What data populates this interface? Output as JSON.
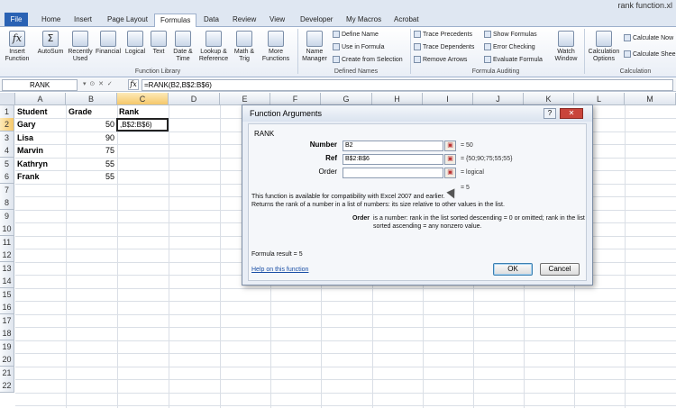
{
  "window": {
    "title": "rank function.xl"
  },
  "ribbon_tabs": [
    {
      "label": "File"
    },
    {
      "label": "Home"
    },
    {
      "label": "Insert"
    },
    {
      "label": "Page Layout"
    },
    {
      "label": "Formulas"
    },
    {
      "label": "Data"
    },
    {
      "label": "Review"
    },
    {
      "label": "View"
    },
    {
      "label": "Developer"
    },
    {
      "label": "My Macros"
    },
    {
      "label": "Acrobat"
    }
  ],
  "ribbon": {
    "insert_function": "Insert Function",
    "autosum": "AutoSum",
    "recently_used": "Recently Used",
    "financial": "Financial",
    "logical": "Logical",
    "text": "Text",
    "date_time": "Date & Time",
    "lookup_reference": "Lookup & Reference",
    "math_trig": "Math & Trig",
    "more_functions": "More Functions",
    "function_library": "Function Library",
    "name_manager": "Name Manager",
    "define_name": "Define Name",
    "use_in_formula": "Use in Formula",
    "create_from_selection": "Create from Selection",
    "defined_names": "Defined Names",
    "trace_precedents": "Trace Precedents",
    "trace_dependents": "Trace Dependents",
    "remove_arrows": "Remove Arrows",
    "show_formulas": "Show Formulas",
    "error_checking": "Error Checking",
    "evaluate_formula": "Evaluate Formula",
    "formula_auditing": "Formula Auditing",
    "watch_window": "Watch Window",
    "calculation_options": "Calculation Options",
    "calculate_now": "Calculate Now",
    "calculate_sheet": "Calculate Shee",
    "calculation": "Calculation"
  },
  "formula_bar": {
    "name_box": "RANK",
    "fx": "fx",
    "formula": "=RANK(B2,B$2:B$6)"
  },
  "columns": [
    "A",
    "B",
    "C",
    "D",
    "E",
    "F",
    "G",
    "H",
    "I",
    "J",
    "K",
    "L",
    "M"
  ],
  "rows": [
    "1",
    "2",
    "3",
    "4",
    "5",
    "6",
    "7",
    "8",
    "9",
    "10",
    "11",
    "12",
    "13",
    "14",
    "15",
    "16",
    "17",
    "18",
    "19",
    "20",
    "21",
    "22"
  ],
  "sheet": {
    "header_student": "Student",
    "header_grade": "Grade",
    "header_rank": "Rank",
    "data": [
      {
        "student": "Gary",
        "grade": "50"
      },
      {
        "student": "Lisa",
        "grade": "90"
      },
      {
        "student": "Marvin",
        "grade": "75"
      },
      {
        "student": "Kathryn",
        "grade": "55"
      },
      {
        "student": "Frank",
        "grade": "55"
      }
    ],
    "active_cell_text": ",B$2:B$6)"
  },
  "dialog": {
    "title": "Function Arguments",
    "function_name": "RANK",
    "number_label": "Number",
    "number_value": "B2",
    "number_result": "=  50",
    "ref_label": "Ref",
    "ref_value": "B$2:B$6",
    "ref_result": "=  {50;90;75;55;55}",
    "order_label": "Order",
    "order_value": "",
    "order_result": "=  logical",
    "total_result": "=  5",
    "description_1": "This function is available for compatibility with Excel 2007 and earlier.",
    "description_2": "Returns the rank of a number in a list of numbers: its size relative to other values in the list.",
    "arg_name": "Order",
    "arg_desc_1": "is a number: rank in the list sorted descending = 0 or omitted; rank in the list",
    "arg_desc_2": "sorted ascending = any nonzero value.",
    "formula_result": "Formula result =   5",
    "help_link": "Help on this function",
    "ok_label": "OK",
    "cancel_label": "Cancel"
  }
}
